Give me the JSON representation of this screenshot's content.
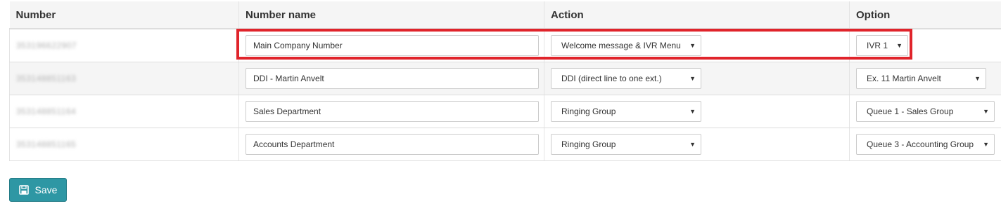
{
  "table": {
    "headers": {
      "number": "Number",
      "number_name": "Number name",
      "action": "Action",
      "option": "Option"
    },
    "rows": [
      {
        "number": "353196622907",
        "number_name": "Main Company Number",
        "action": "Welcome message & IVR Menu",
        "option": "IVR 1"
      },
      {
        "number": "353148851163",
        "number_name": "DDI - Martin Anvelt",
        "action": "DDI (direct line to one ext.)",
        "option": "Ex. 11 Martin Anvelt"
      },
      {
        "number": "353148851164",
        "number_name": "Sales Department",
        "action": "Ringing Group",
        "option": "Queue 1 - Sales Group"
      },
      {
        "number": "353148851165",
        "number_name": "Accounts Department",
        "action": "Ringing Group",
        "option": "Queue 3 - Accounting Group"
      }
    ]
  },
  "actions": {
    "save_label": "Save"
  },
  "icons": {
    "save": "floppy-disk-icon",
    "dropdown": "caret-down-icon"
  },
  "colors": {
    "highlight": "#e0242b",
    "save_button": "#2e97a4",
    "header_bg": "#f5f5f5",
    "alt_row_bg": "#f5f5f5"
  }
}
